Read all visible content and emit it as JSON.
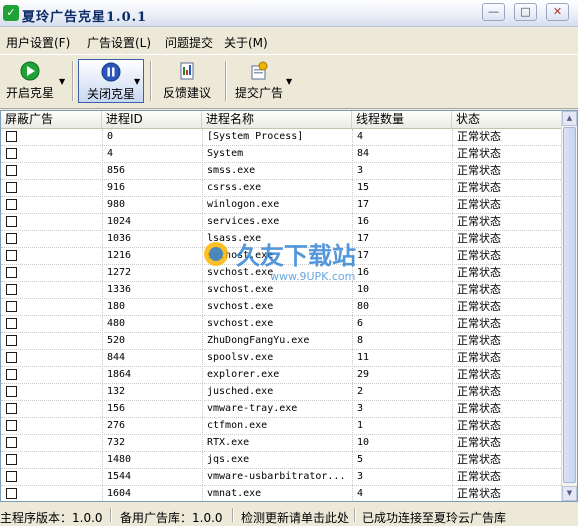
{
  "window": {
    "title": "夏玲广告克星1.0.1",
    "minimize": "—",
    "restore": "□",
    "close": "✕"
  },
  "menu": [
    "用户设置(F)",
    "广告设置(L)",
    "问题提交",
    "关于(M)"
  ],
  "toolbar": {
    "start": "开启克星",
    "stop": "关闭克星",
    "feedback": "反馈建议",
    "submit_ad": "提交广告"
  },
  "columns": [
    "屏蔽广告",
    "进程ID",
    "进程名称",
    "线程数量",
    "状态"
  ],
  "rows": [
    {
      "pid": "0",
      "name": "[System Process]",
      "threads": "4",
      "status": "正常状态"
    },
    {
      "pid": "4",
      "name": "System",
      "threads": "84",
      "status": "正常状态"
    },
    {
      "pid": "856",
      "name": "smss.exe",
      "threads": "3",
      "status": "正常状态"
    },
    {
      "pid": "916",
      "name": "csrss.exe",
      "threads": "15",
      "status": "正常状态"
    },
    {
      "pid": "980",
      "name": "winlogon.exe",
      "threads": "17",
      "status": "正常状态"
    },
    {
      "pid": "1024",
      "name": "services.exe",
      "threads": "16",
      "status": "正常状态"
    },
    {
      "pid": "1036",
      "name": "lsass.exe",
      "threads": "17",
      "status": "正常状态"
    },
    {
      "pid": "1216",
      "name": "svchost.exe",
      "threads": "17",
      "status": "正常状态"
    },
    {
      "pid": "1272",
      "name": "svchost.exe",
      "threads": "16",
      "status": "正常状态"
    },
    {
      "pid": "1336",
      "name": "svchost.exe",
      "threads": "10",
      "status": "正常状态"
    },
    {
      "pid": "180",
      "name": "svchost.exe",
      "threads": "80",
      "status": "正常状态"
    },
    {
      "pid": "480",
      "name": "svchost.exe",
      "threads": "6",
      "status": "正常状态"
    },
    {
      "pid": "520",
      "name": "ZhuDongFangYu.exe",
      "threads": "8",
      "status": "正常状态"
    },
    {
      "pid": "844",
      "name": "spoolsv.exe",
      "threads": "11",
      "status": "正常状态"
    },
    {
      "pid": "1864",
      "name": "explorer.exe",
      "threads": "29",
      "status": "正常状态"
    },
    {
      "pid": "132",
      "name": "jusched.exe",
      "threads": "2",
      "status": "正常状态"
    },
    {
      "pid": "156",
      "name": "vmware-tray.exe",
      "threads": "3",
      "status": "正常状态"
    },
    {
      "pid": "276",
      "name": "ctfmon.exe",
      "threads": "1",
      "status": "正常状态"
    },
    {
      "pid": "732",
      "name": "RTX.exe",
      "threads": "10",
      "status": "正常状态"
    },
    {
      "pid": "1480",
      "name": "jqs.exe",
      "threads": "5",
      "status": "正常状态"
    },
    {
      "pid": "1544",
      "name": "vmware-usbarbitrator...",
      "threads": "3",
      "status": "正常状态"
    },
    {
      "pid": "1604",
      "name": "vmnat.exe",
      "threads": "4",
      "status": "正常状态"
    }
  ],
  "statusbar": {
    "version": "主程序版本：1.0.0",
    "db": "备用广告库：1.0.0",
    "update": "检测更新请单击此处",
    "connected": "已成功连接至夏玲云广告库"
  },
  "watermark": {
    "big": "久友下载站",
    "url": "www.9UPK.com"
  },
  "colors": {
    "start": "#1fa336",
    "stop": "#2a56b8",
    "accent": "#0b2a66"
  }
}
